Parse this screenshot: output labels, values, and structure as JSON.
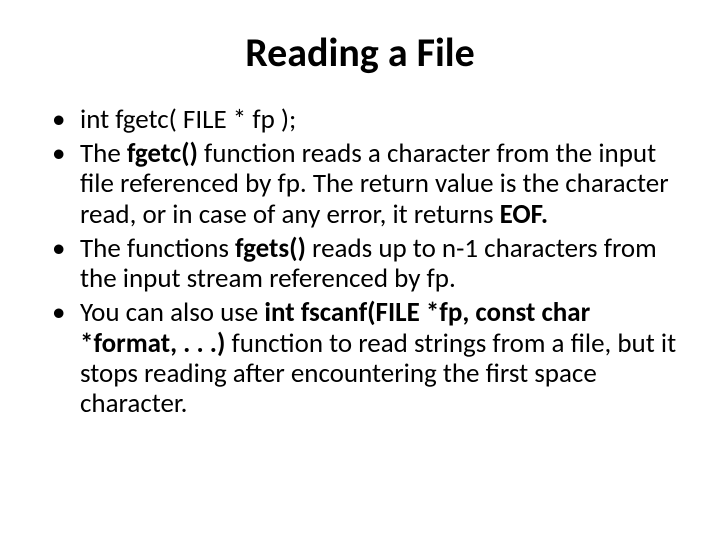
{
  "title": "Reading a File",
  "bullets": {
    "b1": {
      "t1": "int fgetc( FILE * fp );"
    },
    "b2": {
      "t1": "The ",
      "t2": "fgetc()",
      "t3": " function reads a character from the input file referenced by fp. The return value is the character read, or in case of any error, it returns ",
      "t4": "EOF."
    },
    "b3": {
      "t1": "The functions ",
      "t2": "fgets()",
      "t3": " reads up to n-1 characters from the input stream referenced by fp."
    },
    "b4": {
      "t1": "You can also use ",
      "t2": "int fscanf(FILE *fp, const char *format, . . .)",
      "t3": " function to read strings from a file, but it stops reading after encountering the first space character."
    }
  }
}
